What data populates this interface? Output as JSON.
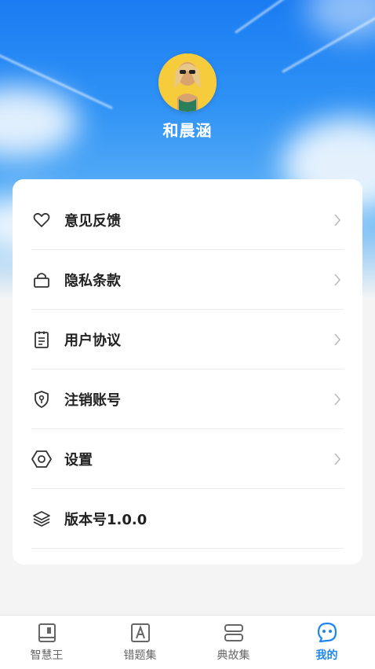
{
  "profile": {
    "name": "和晨涵"
  },
  "menu": {
    "items": [
      {
        "label": "意见反馈",
        "icon": "heart-icon"
      },
      {
        "label": "隐私条款",
        "icon": "lock-icon"
      },
      {
        "label": "用户协议",
        "icon": "document-icon"
      },
      {
        "label": "注销账号",
        "icon": "shield-key-icon"
      },
      {
        "label": "设置",
        "icon": "hexagon-settings-icon"
      },
      {
        "label": "版本号1.0.0",
        "icon": "layers-icon"
      }
    ]
  },
  "tabbar": {
    "tabs": [
      {
        "label": "智慧王",
        "icon": "book-icon"
      },
      {
        "label": "错题集",
        "icon": "letter-a-icon"
      },
      {
        "label": "典故集",
        "icon": "stack-icon"
      },
      {
        "label": "我的",
        "icon": "smiley-bubble-icon"
      }
    ],
    "active": "我的",
    "active_color": "#1e86f0",
    "inactive_color": "#666666"
  }
}
